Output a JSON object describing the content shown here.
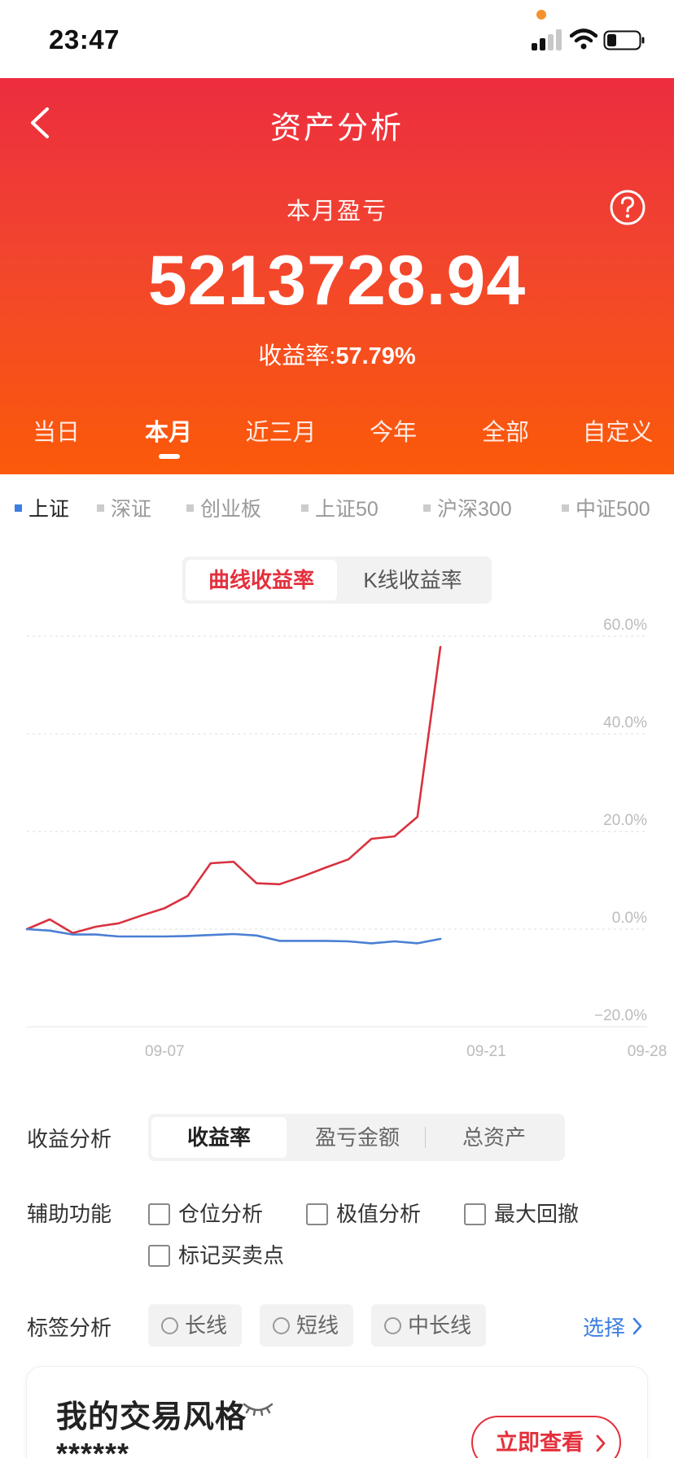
{
  "status_bar": {
    "time": "23:47",
    "icons": [
      "cellular-signal-icon",
      "wifi-icon",
      "battery-icon"
    ],
    "dot_color": "#f5922b"
  },
  "header": {
    "title": "资产分析",
    "back_icon": "chevron-left-icon",
    "help_icon": "question-circle-icon",
    "subtitle": "本月盈亏",
    "amount": "5213728.94",
    "rate_label": "收益率:",
    "rate_value": "57.79%",
    "gradient_top": "#ec2d3f",
    "gradient_bottom": "#fb5a09"
  },
  "period_tabs": [
    "当日",
    "本月",
    "近三月",
    "今年",
    "全部",
    "自定义"
  ],
  "period_active": "本月",
  "index_tabs": [
    "上证",
    "深证",
    "创业板",
    "上证50",
    "沪深300",
    "中证500"
  ],
  "index_active": "上证",
  "mode_toggle": {
    "options": [
      "曲线收益率",
      "K线收益率"
    ],
    "active": "曲线收益率"
  },
  "chart_data": {
    "type": "line",
    "y_tick_labels": [
      "60.0%",
      "40.0%",
      "20.0%",
      "0.0%",
      "−20.0%"
    ],
    "y_ticks": [
      60,
      40,
      20,
      0,
      -20
    ],
    "ylim": [
      -20,
      60
    ],
    "x_tick_labels": [
      "09-07",
      "09-21",
      "09-28"
    ],
    "x_ticks": [
      "2023-09-07",
      "2023-09-21",
      "2023-09-28"
    ],
    "xlim": [
      "2023-09-01",
      "2023-09-28"
    ],
    "grid": true,
    "series": [
      {
        "color": "#d8323f",
        "x": [
          "2023-09-01",
          "2023-09-02",
          "2023-09-03",
          "2023-09-04",
          "2023-09-05",
          "2023-09-06",
          "2023-09-07",
          "2023-09-08",
          "2023-09-09",
          "2023-09-10",
          "2023-09-11",
          "2023-09-12",
          "2023-09-13",
          "2023-09-14",
          "2023-09-15",
          "2023-09-16",
          "2023-09-17",
          "2023-09-18",
          "2023-09-19"
        ],
        "values": [
          0.0,
          2.0,
          -0.8,
          0.5,
          1.2,
          2.8,
          4.3,
          6.8,
          13.5,
          13.8,
          9.4,
          9.2,
          10.8,
          12.6,
          14.3,
          18.5,
          19.0,
          23.0,
          57.8
        ]
      },
      {
        "color": "#4a7fd4",
        "x": [
          "2023-09-01",
          "2023-09-02",
          "2023-09-03",
          "2023-09-04",
          "2023-09-05",
          "2023-09-06",
          "2023-09-07",
          "2023-09-08",
          "2023-09-09",
          "2023-09-10",
          "2023-09-11",
          "2023-09-12",
          "2023-09-13",
          "2023-09-14",
          "2023-09-15",
          "2023-09-16",
          "2023-09-17",
          "2023-09-18",
          "2023-09-19"
        ],
        "values": [
          0.0,
          -0.3,
          -1.1,
          -1.1,
          -1.5,
          -1.5,
          -1.5,
          -1.4,
          -1.2,
          -1.0,
          -1.3,
          -2.4,
          -2.4,
          -2.4,
          -2.5,
          -2.9,
          -2.5,
          -2.9,
          -2.0
        ]
      }
    ]
  },
  "profit_analysis": {
    "label": "收益分析",
    "options": [
      "收益率",
      "盈亏金额",
      "总资产"
    ],
    "active": "收益率"
  },
  "aux_functions": {
    "label": "辅助功能",
    "items": [
      "仓位分析",
      "极值分析",
      "最大回撤",
      "标记买卖点"
    ]
  },
  "tag_analysis": {
    "label": "标签分析",
    "tags": [
      "长线",
      "短线",
      "中长线"
    ],
    "select_label": "选择"
  },
  "style_card": {
    "title": "我的交易风格",
    "masked_value": "******",
    "button_label": "立即查看",
    "eye_icon": "eye-closed-icon"
  },
  "colors": {
    "accent": "#e4303c",
    "link": "#3d7ee0",
    "index_active": "#3d7ee0"
  }
}
